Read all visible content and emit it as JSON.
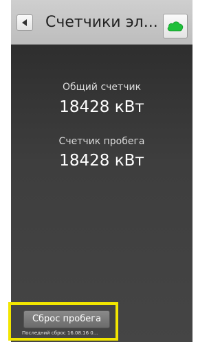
{
  "header": {
    "title": "Счетчики эл...",
    "back_icon": "back-arrow-icon",
    "cloud_icon": "cloud-icon",
    "cloud_color": "#1fbf3a"
  },
  "counters": {
    "total_label": "Общий счетчик",
    "total_value": "18428 кВт",
    "trip_label": "Счетчик пробега",
    "trip_value": "18428 кВт"
  },
  "reset": {
    "button_label": "Сброс пробега",
    "last_reset_text": "Последний сброс 16.08.16 0..."
  },
  "colors": {
    "highlight": "#f2e600"
  }
}
